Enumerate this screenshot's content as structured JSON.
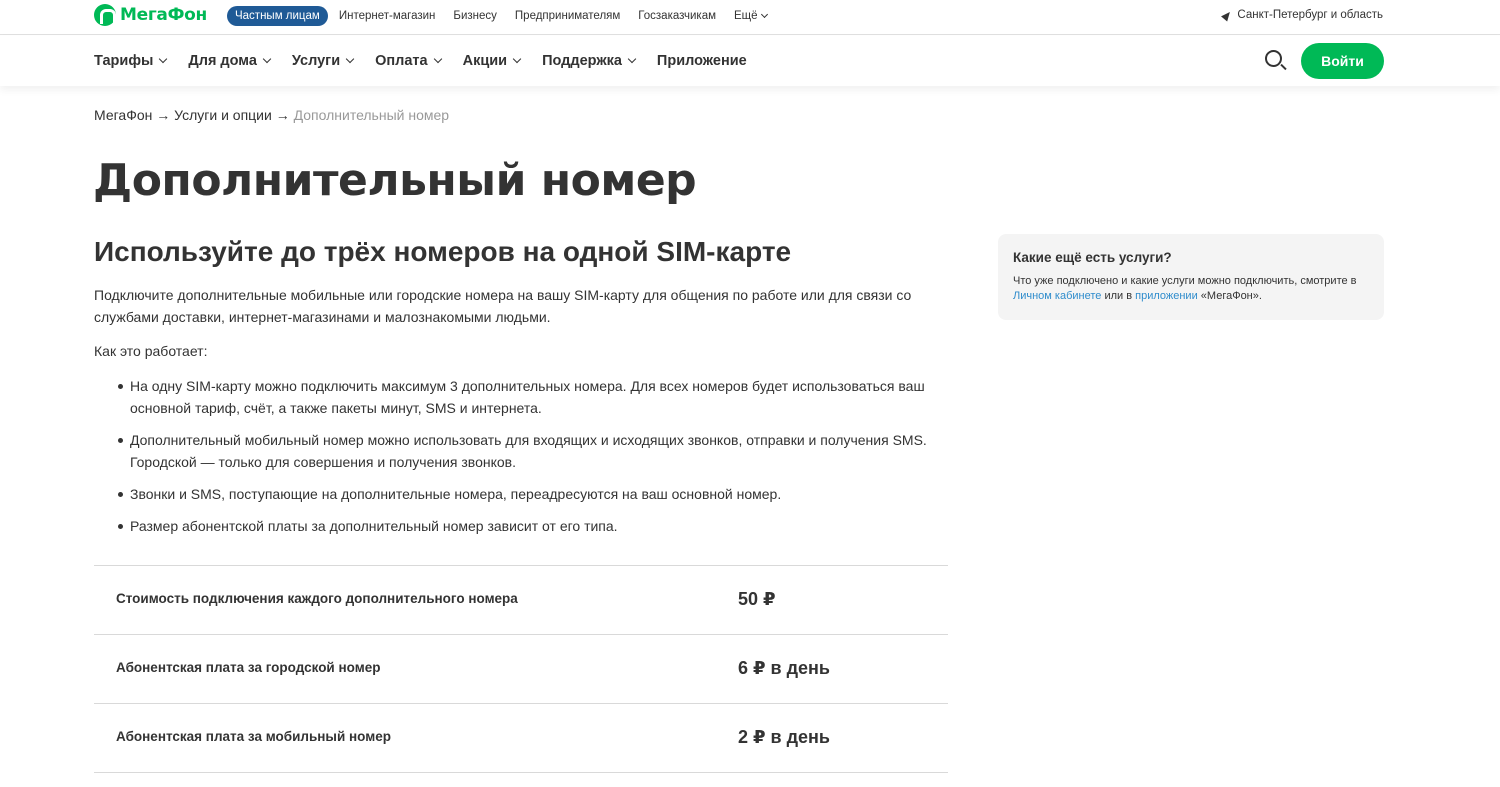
{
  "brand": {
    "name": "МегаФон",
    "accent": "#00b956",
    "nav_active": "#1f5a96",
    "link": "#2f8ccc"
  },
  "segments": {
    "items": [
      {
        "label": "Частным лицам",
        "active": true
      },
      {
        "label": "Интернет-магазин"
      },
      {
        "label": "Бизнесу"
      },
      {
        "label": "Предпринимателям"
      },
      {
        "label": "Госзаказчикам"
      }
    ],
    "more_label": "Ещё"
  },
  "region": {
    "label": "Санкт-Петербург и область",
    "icon": "location-arrow-icon"
  },
  "menu": {
    "items": [
      {
        "label": "Тарифы"
      },
      {
        "label": "Для дома"
      },
      {
        "label": "Услуги"
      },
      {
        "label": "Оплата"
      },
      {
        "label": "Акции"
      },
      {
        "label": "Поддержка"
      },
      {
        "label": "Приложение"
      }
    ],
    "login_label": "Войти",
    "search_icon": "search-icon"
  },
  "breadcrumb": {
    "home": "МегаФон",
    "separator1": " → ",
    "section": "Услуги и опции",
    "separator2": " → ",
    "current": "Дополнительный номер"
  },
  "page_title": "Дополнительный номер",
  "subtitle": "Используйте до трёх номеров на одной SIM-карте",
  "intro": "Подключите дополнительные мобильные или городские номера на вашу SIM-карту для общения по работе или для связи со службами доставки, интернет-магазинами и малознакомыми людьми.",
  "how_label": "Как это работает:",
  "bullets": [
    "На одну SIM-карту можно подключить максимум 3 дополнительных номера. Для всех номеров будет использоваться ваш основной тариф, счёт, а также пакеты минут, SMS и интернета.",
    "Дополнительный мобильный номер можно использовать для входящих и исходящих звонков, отправки и получения SMS. Городской — только для совершения и получения звонков.",
    "Звонки и SMS, поступающие на дополнительные номера, переадресуются на ваш основной номер.",
    "Размер абонентской платы за дополнительный номер зависит от его типа."
  ],
  "prices": [
    {
      "label": "Стоимость подключения каждого дополнительного номера",
      "value": "50 ₽"
    },
    {
      "label": "Абонентская плата за городской номер",
      "value": "6 ₽ в день"
    },
    {
      "label": "Абонентская плата за мобильный номер",
      "value": "2 ₽ в день"
    }
  ],
  "sidebar": {
    "title": "Какие ещё есть услуги?",
    "text_before": "Что уже подключено и какие услуги можно подключить, смотрите в ",
    "link1": "Личном кабинете",
    "text_middle": " или в ",
    "link2": "приложении",
    "text_after": " «МегаФон»."
  }
}
